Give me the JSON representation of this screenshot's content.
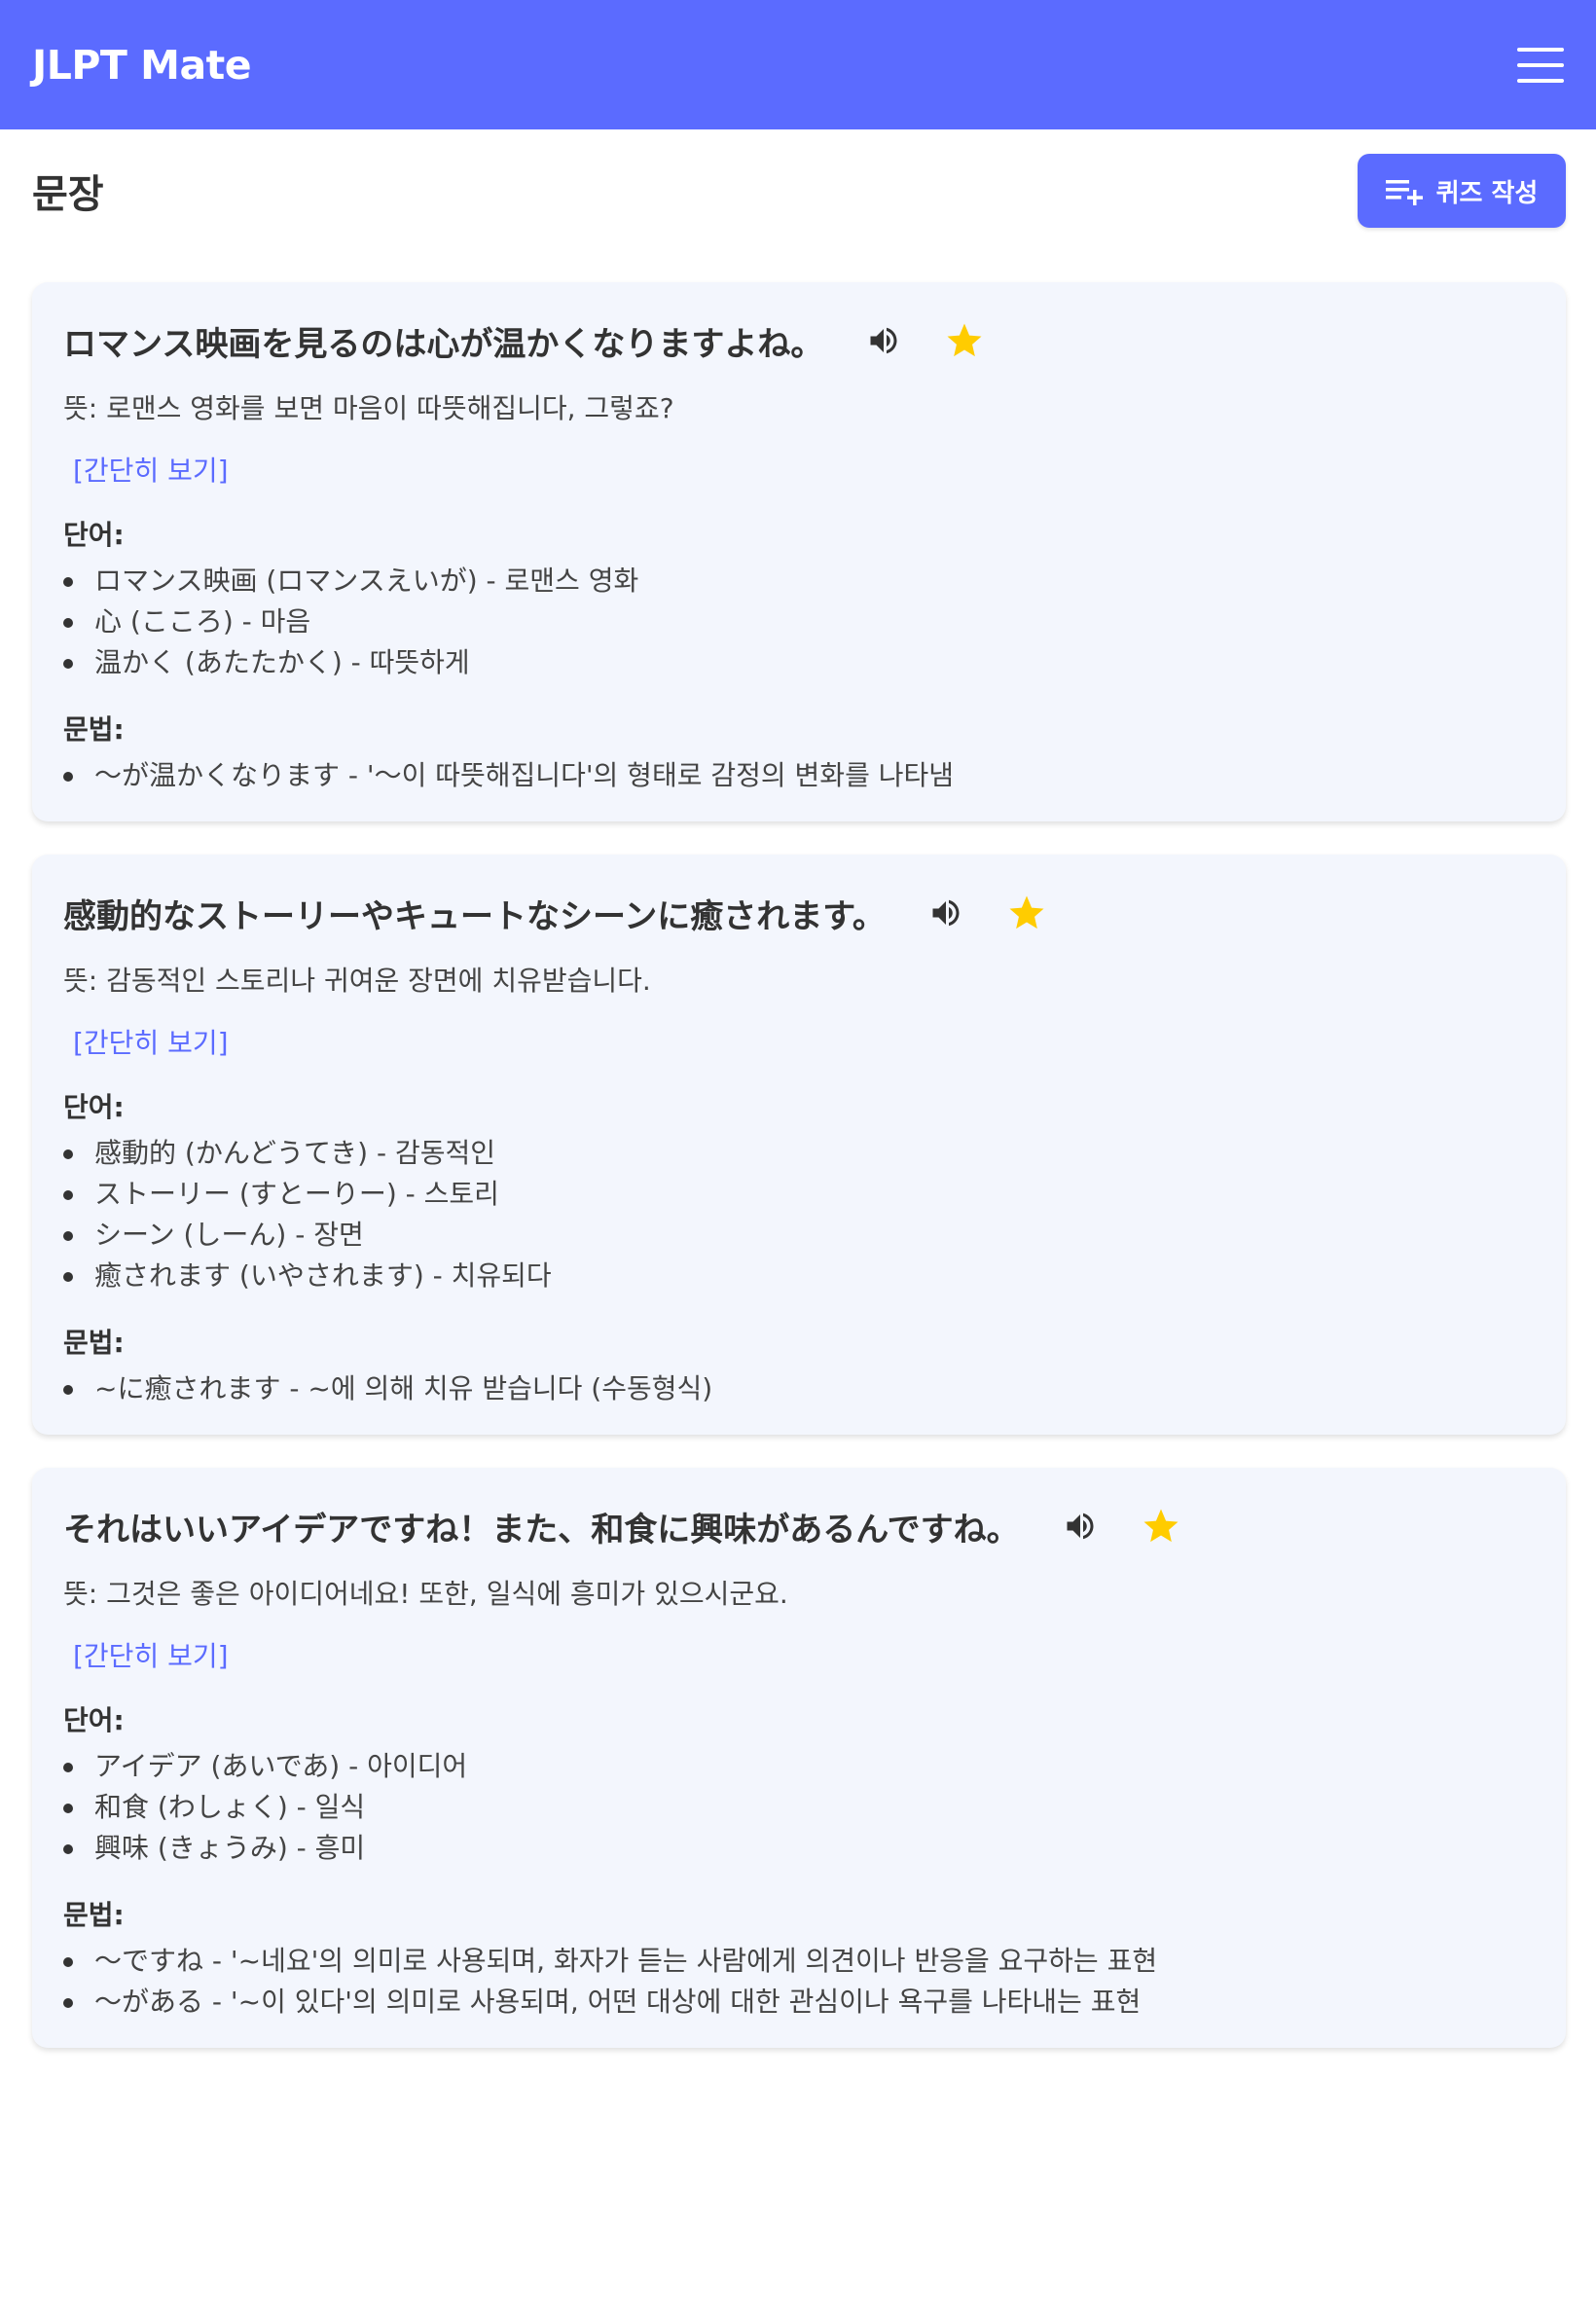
{
  "app": {
    "title": "JLPT Mate",
    "menu_icon": "hamburger-menu-icon"
  },
  "page": {
    "title": "문장",
    "quiz_button_label": "퀴즈 작성",
    "quiz_button_icon": "playlist-add-icon"
  },
  "colors": {
    "primary": "#5b6bff",
    "card_bg": "#f3f6fd",
    "star": "#ffcc00",
    "text": "#333333"
  },
  "labels": {
    "toggle": "[간단히 보기]",
    "vocab_heading": "단어:",
    "grammar_heading": "문법:"
  },
  "cards": [
    {
      "sentence": "ロマンス映画を見るのは心が温かくなりますよね。",
      "meaning": "뜻: 로맨스 영화를 보면 마음이 따뜻해집니다, 그렇죠?",
      "vocab": [
        "ロマンス映画 (ロマンスえいが) - 로맨스 영화",
        "心 (こころ) - 마음",
        "温かく (あたたかく) - 따뜻하게"
      ],
      "grammar": [
        "～が温かくなります - '～이 따뜻해집니다'의 형태로 감정의 변화를 나타냄"
      ],
      "starred": true
    },
    {
      "sentence": "感動的なストーリーやキュートなシーンに癒されます。",
      "meaning": "뜻: 감동적인 스토리나 귀여운 장면에 치유받습니다.",
      "vocab": [
        "感動的 (かんどうてき) - 감동적인",
        "ストーリー (すとーりー) - 스토리",
        "シーン (しーん) - 장면",
        "癒されます (いやされます) - 치유되다"
      ],
      "grammar": [
        "~に癒されます - ~에 의해 치유 받습니다 (수동형식)"
      ],
      "starred": true
    },
    {
      "sentence": "それはいいアイデアですね！また、和食に興味があるんですね。",
      "meaning": "뜻: 그것은 좋은 아이디어네요! 또한, 일식에 흥미가 있으시군요.",
      "vocab": [
        "アイデア (あいであ) - 아이디어",
        "和食 (わしょく) - 일식",
        "興味 (きょうみ) - 흥미"
      ],
      "grammar": [
        "～ですね - '~네요'의 의미로 사용되며, 화자가 듣는 사람에게 의견이나 반응을 요구하는 표현",
        "～がある - '~이 있다'의 의미로 사용되며, 어떤 대상에 대한 관심이나 욕구를 나타내는 표현"
      ],
      "starred": true
    }
  ]
}
